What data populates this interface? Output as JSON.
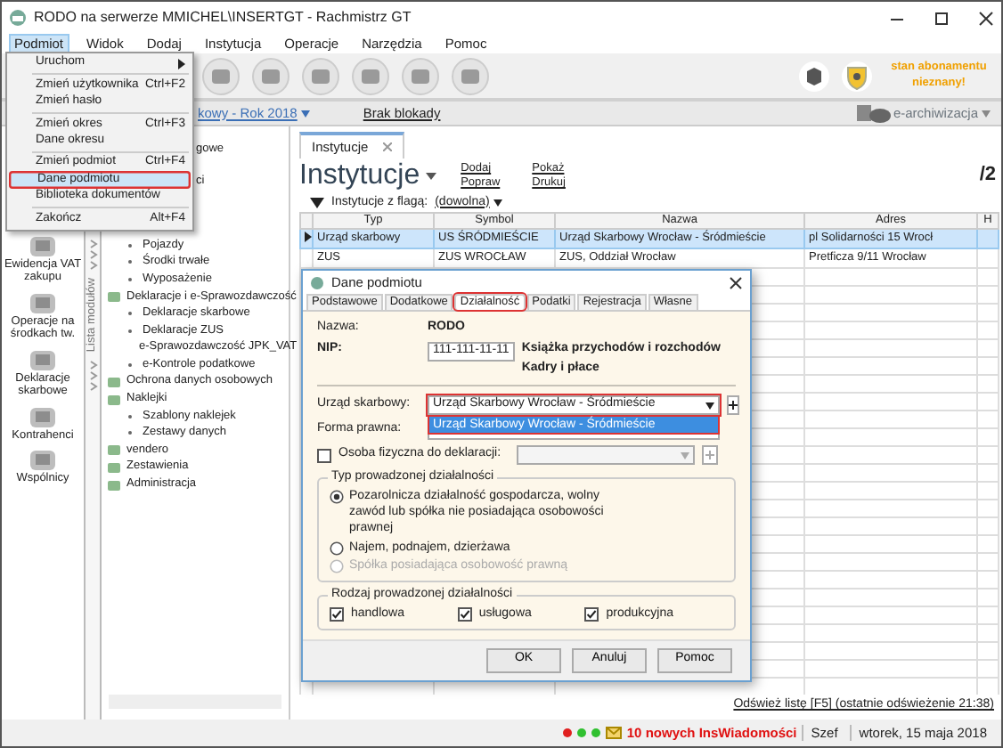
{
  "window": {
    "title": "RODO na serwerze MMICHEL\\INSERTGT - Rachmistrz GT"
  },
  "menu_bar": [
    {
      "label": "Podmiot",
      "selected": true
    },
    {
      "label": "Widok",
      "selected": false
    },
    {
      "label": "Dodaj",
      "selected": false
    },
    {
      "label": "Instytucja",
      "selected": false
    },
    {
      "label": "Operacje",
      "selected": false
    },
    {
      "label": "Narzędzia",
      "selected": false
    },
    {
      "label": "Pomoc",
      "selected": false
    }
  ],
  "podmiot_menu": [
    {
      "kind": "submenu",
      "label": "Uruchom",
      "selected": false
    },
    {
      "kind": "separator"
    },
    {
      "kind": "item",
      "label": "Zmień użytkownika",
      "shortcut": "Ctrl+F2",
      "selected": false
    },
    {
      "kind": "item",
      "label": "Zmień hasło",
      "selected": false
    },
    {
      "kind": "separator"
    },
    {
      "kind": "item",
      "label": "Zmień okres",
      "shortcut": "Ctrl+F3",
      "selected": false
    },
    {
      "kind": "item",
      "label": "Dane okresu",
      "selected": false
    },
    {
      "kind": "separator"
    },
    {
      "kind": "item",
      "label": "Zmień podmiot",
      "shortcut": "Ctrl+F4",
      "selected": false
    },
    {
      "kind": "item",
      "label": "Dane podmiotu",
      "selected": true
    },
    {
      "kind": "item",
      "label": "Biblioteka dokumentów",
      "selected": false
    },
    {
      "kind": "separator"
    },
    {
      "kind": "item",
      "label": "Zakończ",
      "shortcut": "Alt+F4",
      "selected": false
    }
  ],
  "toolbar": {
    "subscription_status": "stan abonamentu nieznany!"
  },
  "context_bar": {
    "period": "kowy - Rok 2018",
    "lock": "Brak blokady",
    "archive": "e-archiwizacja"
  },
  "modules": [
    {
      "label": "Ewidencja VAT zakupu"
    },
    {
      "label": "Operacje na środkach tw."
    },
    {
      "label": "Deklaracje skarbowe"
    },
    {
      "label": "Kontrahenci"
    },
    {
      "label": "Wspólnicy"
    }
  ],
  "modules_strip": "Lista modułów",
  "tree": [
    {
      "kind": "partial",
      "label": "gowe"
    },
    {
      "kind": "partial",
      "label": "ci"
    },
    {
      "kind": "leaf",
      "label": "Pojazdy"
    },
    {
      "kind": "leaf",
      "label": "Środki trwałe"
    },
    {
      "kind": "leaf",
      "label": "Wyposażenie"
    },
    {
      "kind": "group",
      "label": "Deklaracje i e-Sprawozdawczość",
      "children": [
        {
          "kind": "leaf",
          "label": "Deklaracje skarbowe"
        },
        {
          "kind": "leaf",
          "label": "Deklaracje ZUS"
        },
        {
          "kind": "leaf",
          "label": "e-Sprawozdawczość JPK_VAT"
        },
        {
          "kind": "leaf",
          "label": "e-Kontrole podatkowe"
        }
      ]
    },
    {
      "kind": "group",
      "label": "Ochrona danych osobowych"
    },
    {
      "kind": "group",
      "label": "Naklejki",
      "children": [
        {
          "kind": "leaf",
          "label": "Szablony naklejek"
        },
        {
          "kind": "leaf",
          "label": "Zestawy danych"
        }
      ]
    },
    {
      "kind": "group",
      "label": "vendero"
    },
    {
      "kind": "group",
      "label": "Zestawienia"
    },
    {
      "kind": "group",
      "label": "Administracja"
    }
  ],
  "tabs": [
    {
      "label": "Instytucje",
      "selected": true
    }
  ],
  "page": {
    "title": "Instytucje",
    "actions": [
      "Dodaj",
      "Popraw",
      "Pokaż",
      "Drukuj"
    ],
    "page_count": "/2",
    "filter_label": "Instytucje z flagą:",
    "filter_value": "(dowolna)"
  },
  "table": {
    "columns": [
      "Typ",
      "Symbol",
      "Nazwa",
      "Adres",
      "H"
    ],
    "rows": [
      {
        "cells": [
          "Urząd skarbowy",
          "US ŚRÓDMIEŚCIE",
          "Urząd Skarbowy Wrocław - Śródmieście",
          "pl Solidarności 15 Wrocł"
        ],
        "selected": true
      },
      {
        "cells": [
          "ZUS",
          "ZUS WROCŁAW",
          "ZUS, Oddział Wrocław",
          "Pretficza 9/11 Wrocław"
        ],
        "selected": false
      }
    ]
  },
  "refresh": "Odśwież listę [F5] (ostatnie odświeżenie 21:38)",
  "status_bar": {
    "indicators": [
      {
        "color": "#e02020"
      },
      {
        "color": "#30c030"
      },
      {
        "color": "#30c030"
      }
    ],
    "messages": "10 nowych InsWiadomości",
    "user": "Szef",
    "date": "wtorek, 15 maja 2018"
  },
  "dialog": {
    "title": "Dane podmiotu",
    "tabs": [
      {
        "label": "Podstawowe",
        "selected": false
      },
      {
        "label": "Dodatkowe",
        "selected": false
      },
      {
        "label": "Działalność",
        "selected": true
      },
      {
        "label": "Podatki",
        "selected": false
      },
      {
        "label": "Rejestracja",
        "selected": false
      },
      {
        "label": "Własne",
        "selected": false
      }
    ],
    "name_label": "Nazwa:",
    "name": "RODO",
    "nip_label": "NIP:",
    "nip": "111-111-11-11",
    "registers": [
      "Książka przychodów i rozchodów",
      "Kadry i płace"
    ],
    "tax_office_label": "Urząd skarbowy:",
    "tax_office": "Urząd Skarbowy Wrocław - Śródmieście",
    "tax_office_options": [
      {
        "label": "Urząd Skarbowy Wrocław - Śródmieście",
        "selected": true
      }
    ],
    "legal_form_label": "Forma prawna:",
    "natural_person": {
      "label": "Osoba fizyczna do deklaracji:",
      "checked": false
    },
    "activity_type": {
      "legend": "Typ prowadzonej działalności",
      "options": [
        {
          "label": "Pozarolnicza działalność gospodarcza, wolny zawód lub spółka nie posiadająca osobowości prawnej",
          "selected": true,
          "disabled": false
        },
        {
          "label": "Najem, podnajem, dzierżawa",
          "selected": false,
          "disabled": false
        },
        {
          "label": "Spółka posiadająca osobowość prawną",
          "selected": false,
          "disabled": true
        }
      ]
    },
    "activity_kind": {
      "legend": "Rodzaj prowadzonej działalności",
      "options": [
        {
          "label": "handlowa",
          "checked": true
        },
        {
          "label": "usługowa",
          "checked": true
        },
        {
          "label": "produkcyjna",
          "checked": true
        }
      ]
    },
    "buttons": [
      "OK",
      "Anuluj",
      "Pomoc"
    ]
  }
}
